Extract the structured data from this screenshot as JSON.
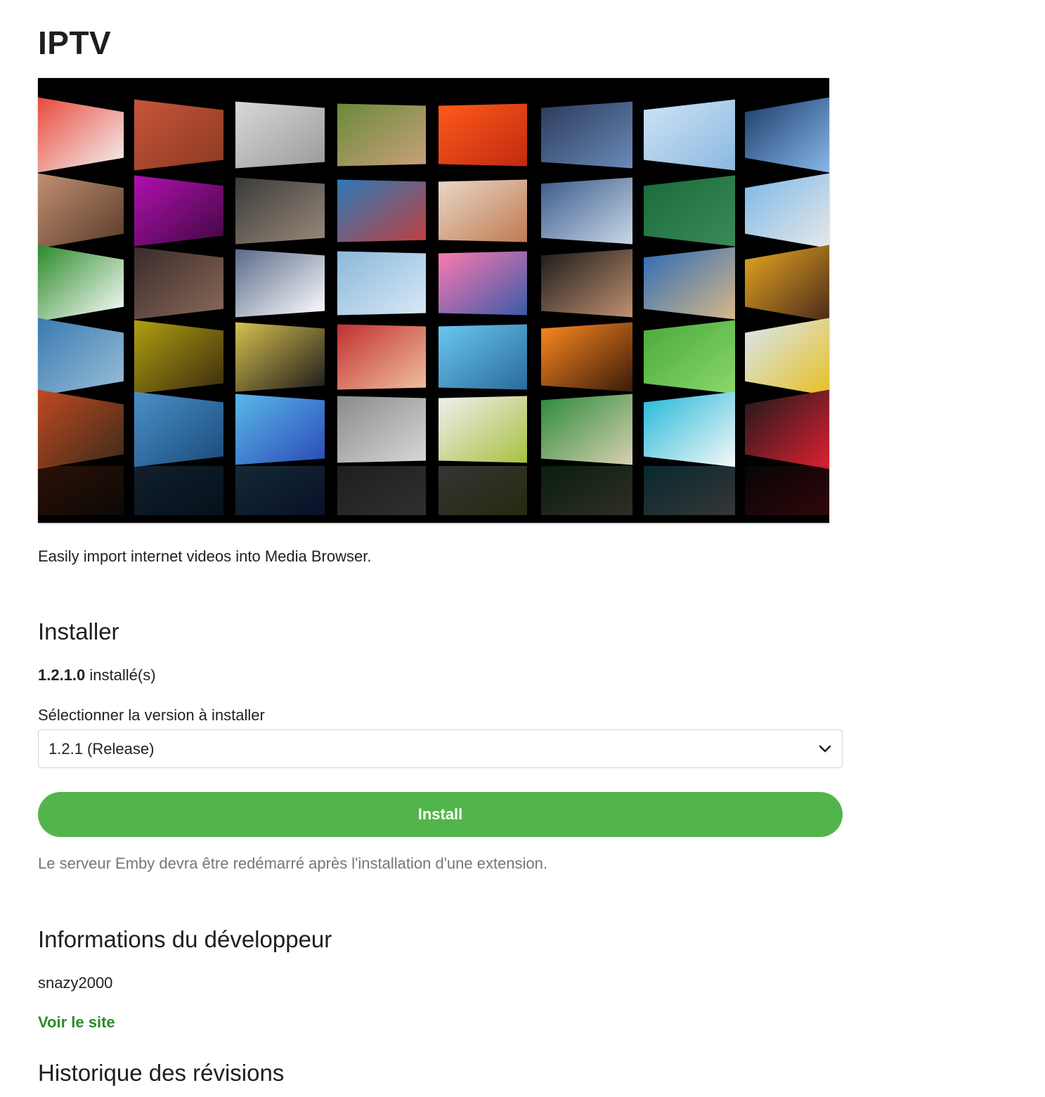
{
  "plugin": {
    "title": "IPTV",
    "description": "Easily import internet videos into Media Browser."
  },
  "install": {
    "heading": "Installer",
    "installed_version": "1.2.1.0",
    "installed_suffix": " installé(s)",
    "select_label": "Sélectionner la version à installer",
    "selected_version": "1.2.1 (Release)",
    "install_button": "Install",
    "restart_note": "Le serveur Emby devra être redémarré après l'installation d'une extension."
  },
  "developer": {
    "heading": "Informations du développeur",
    "name": "snazy2000",
    "site_link": "Voir le site"
  },
  "history": {
    "heading": "Historique des révisions"
  },
  "colors": {
    "accent": "#52b54b",
    "link": "#2a8c2a"
  }
}
